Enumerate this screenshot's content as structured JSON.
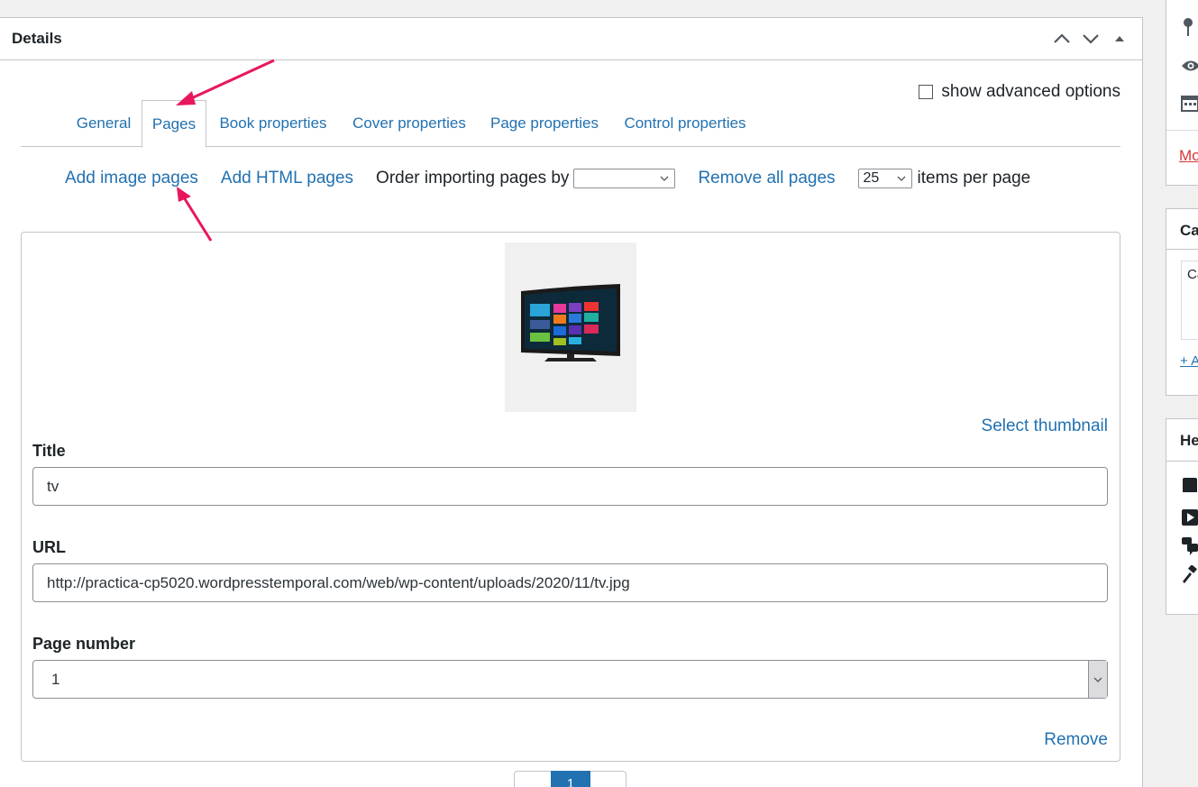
{
  "details_box": {
    "title": "Details",
    "advanced_options_label": "show advanced options"
  },
  "tabs": [
    {
      "label": "General",
      "active": false
    },
    {
      "label": "Pages",
      "active": true
    },
    {
      "label": "Book properties",
      "active": false
    },
    {
      "label": "Cover properties",
      "active": false
    },
    {
      "label": "Page properties",
      "active": false
    },
    {
      "label": "Control properties",
      "active": false
    }
  ],
  "toolbar": {
    "add_image_pages": "Add image pages",
    "add_html_pages": "Add HTML pages",
    "order_label": "Order importing pages by",
    "order_value": "",
    "remove_all": "Remove all pages",
    "per_page_value": "25",
    "per_page_label": "items per page"
  },
  "page_item": {
    "thumbnail_icon": "tv-image",
    "select_thumbnail": "Select thumbnail",
    "title_label": "Title",
    "title_value": "tv",
    "url_label": "URL",
    "url_value": "http://practica-cp5020.wordpresstemporal.com/web/wp-content/uploads/2020/11/tv.jpg",
    "page_number_label": "Page number",
    "page_number_value": "1",
    "remove": "Remove"
  },
  "pagination": {
    "current": "1"
  },
  "sidebar": {
    "more_link": "Mo",
    "categories_title": "Ca",
    "categories_item": "Ca",
    "add_link": "+ A",
    "help_title": "He"
  },
  "colors": {
    "link": "#2271b1",
    "annotation_arrow": "#e8175d",
    "delete_link": "#d63638"
  }
}
